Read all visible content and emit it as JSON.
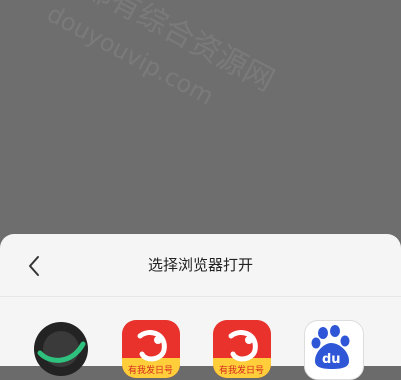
{
  "watermark": {
    "line1": "全都有综合资源网",
    "line2": "douyouvip.com"
  },
  "sheet": {
    "title": "选择浏览器打开",
    "back_icon": "chevron-left-icon"
  },
  "apps": [
    {
      "name": "dark-browser",
      "icon": "dark-circle-browser-icon"
    },
    {
      "name": "uc-browser-1",
      "icon": "uc-browser-icon",
      "caption": "有我发日号"
    },
    {
      "name": "uc-browser-2",
      "icon": "uc-browser-icon",
      "caption": "有我发日号"
    },
    {
      "name": "baidu",
      "icon": "baidu-paw-icon",
      "label": "du"
    }
  ],
  "colors": {
    "overlay": "#6e6e6e",
    "sheet_bg": "#f5f5f5",
    "uc_red": "#e8322b",
    "uc_yellow": "#ffce3a",
    "baidu_blue": "#2e56d6"
  }
}
